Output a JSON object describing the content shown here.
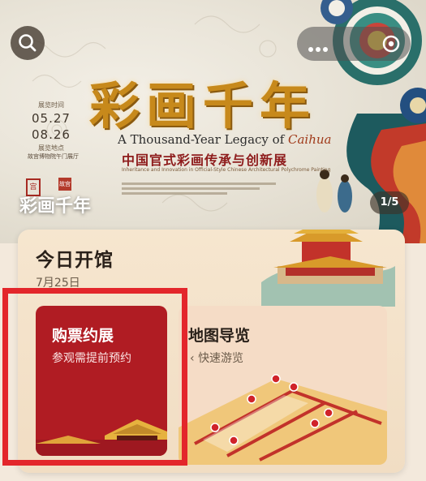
{
  "banner": {
    "title": "彩画千年",
    "title_en_prefix": "A Thousand-Year Legacy of ",
    "title_en_em": "Caihua",
    "title_cn": "中国官式彩画传承与创新展",
    "subtitle": "Inheritance and Innovation in Official-Style Chinese Architectural Polychrome Painting",
    "date_label_top": "展览时间",
    "date_start": "05.27",
    "date_end": "08.26",
    "place_label": "展览地点",
    "place": "故宫博物院午门展厅",
    "seal_text": "宫",
    "seal2_text": "故宫",
    "label": "彩画千年",
    "pager": "1/5"
  },
  "today": {
    "title": "今日开馆",
    "date": "7月25日"
  },
  "ticket": {
    "title": "购票约展",
    "subtitle": "参观需提前预约"
  },
  "map": {
    "title": "地图导览",
    "subtitle": "快速游览"
  },
  "colors": {
    "accent_red": "#b01c23",
    "highlight": "#e3262b",
    "gold": "#c7891b"
  },
  "icons": {
    "search": "search-icon",
    "more": "more-dots-icon",
    "target": "target-icon"
  }
}
